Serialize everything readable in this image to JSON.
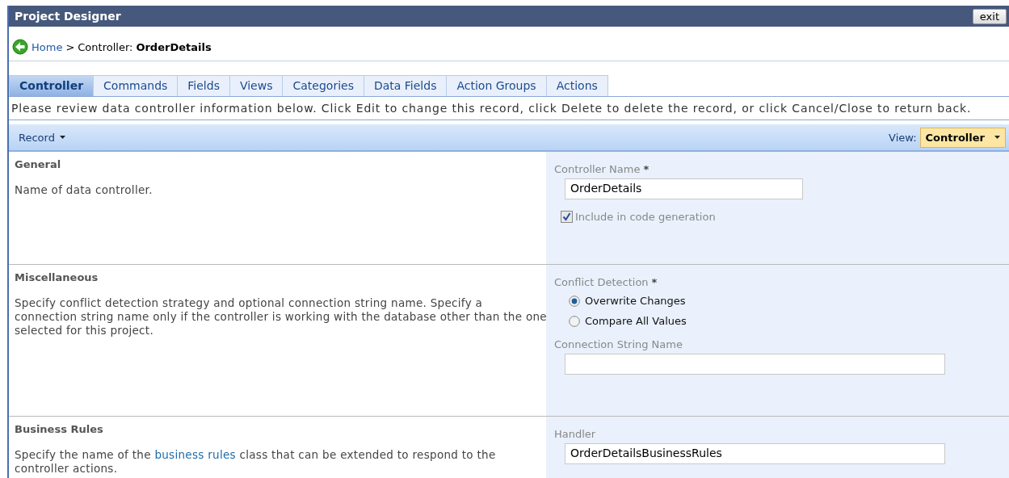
{
  "window": {
    "title": "Project Designer",
    "exit_button": "exit"
  },
  "breadcrumb": {
    "home": "Home",
    "separator": ">",
    "label": "Controller:",
    "current": "OrderDetails"
  },
  "tabs": [
    {
      "label": "Controller",
      "selected": true
    },
    {
      "label": "Commands",
      "selected": false
    },
    {
      "label": "Fields",
      "selected": false
    },
    {
      "label": "Views",
      "selected": false
    },
    {
      "label": "Categories",
      "selected": false
    },
    {
      "label": "Data Fields",
      "selected": false
    },
    {
      "label": "Action Groups",
      "selected": false
    },
    {
      "label": "Actions",
      "selected": false
    }
  ],
  "info": "Please review data controller information below. Click Edit to change this record, click Delete to delete the record, or click Cancel/Close to return back.",
  "toolbar": {
    "menu": "Record",
    "view_label": "View:",
    "view_value": "Controller"
  },
  "sections": [
    {
      "title": "General",
      "description": [
        {
          "kind": "text",
          "text": "Name of data controller."
        }
      ],
      "fields": [
        {
          "kind": "text",
          "label": "Controller Name",
          "required_mark": "*",
          "value": "OrderDetails"
        },
        {
          "kind": "checkbox",
          "label": "Include in code generation",
          "checked": true
        }
      ]
    },
    {
      "title": "Miscellaneous",
      "description": [
        {
          "kind": "text",
          "text": "Specify conflict detection strategy and optional connection string name. Specify a connection string name only if the controller is working with the database other than the one selected for this project."
        }
      ],
      "fields": [
        {
          "kind": "radio",
          "label": "Conflict Detection",
          "required_mark": "*",
          "options": [
            {
              "label": "Overwrite Changes",
              "selected": true
            },
            {
              "label": "Compare All Values",
              "selected": false
            }
          ]
        },
        {
          "kind": "text",
          "label": "Connection String Name"
        }
      ]
    },
    {
      "title": "Business Rules",
      "description": [
        {
          "kind": "text",
          "text": "Specify the name of the "
        },
        {
          "kind": "link",
          "text": "business rules"
        },
        {
          "kind": "text",
          "text": " class that can be extended to respond to the controller actions."
        }
      ],
      "fields": [
        {
          "kind": "text",
          "label": "Handler",
          "value": "OrderDetailsBusinessRules"
        }
      ]
    }
  ]
}
